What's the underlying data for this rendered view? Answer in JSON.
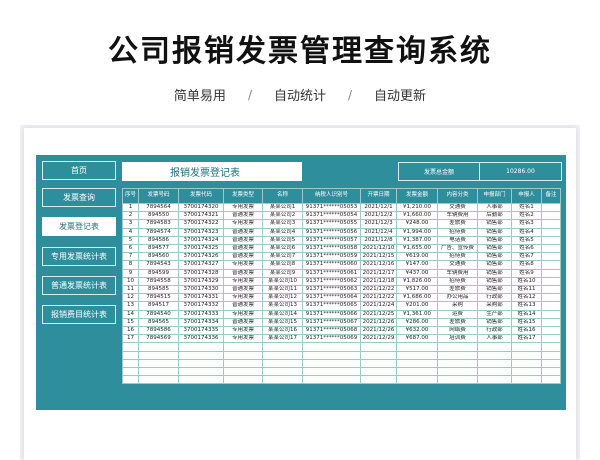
{
  "header": {
    "title": "公司报销发票管理查询系统",
    "features": [
      "简单易用",
      "自动统计",
      "自动更新"
    ]
  },
  "sidebar": {
    "items": [
      {
        "label": "首页",
        "active": false
      },
      {
        "label": "发票查询",
        "active": false
      },
      {
        "label": "发票登记表",
        "active": true
      },
      {
        "label": "专用发票统计表",
        "active": false
      },
      {
        "label": "普通发票统计表",
        "active": false
      },
      {
        "label": "报销费目统计表",
        "active": false
      }
    ]
  },
  "sheet": {
    "title": "报销发票登记表",
    "total_label": "发票总金额",
    "total_value": "10286.00"
  },
  "table": {
    "columns": [
      "序号",
      "发票号码",
      "发票代码",
      "发票类型",
      "名称",
      "纳税人识别号",
      "开票日期",
      "发票金额",
      "内容分类",
      "申报部门",
      "申报人",
      "备注"
    ],
    "rows": [
      [
        "1",
        "7894564",
        "3700174320",
        "专用发票",
        "某某公司1",
        "91371******05053",
        "2021/12/1",
        "¥1,210.00",
        "交通费",
        "人事部",
        "姓名1",
        ""
      ],
      [
        "2",
        "894550",
        "3700174321",
        "普通发票",
        "某某公司2",
        "91371******05054",
        "2021/12/2",
        "¥1,660.00",
        "车辆费用",
        "后勤部",
        "姓名2",
        ""
      ],
      [
        "3",
        "7894583",
        "3700174322",
        "专用发票",
        "某某公司3",
        "91371******05055",
        "2021/12/3",
        "¥248.00",
        "差旅费",
        "销售部",
        "姓名3",
        ""
      ],
      [
        "4",
        "7894574",
        "3700174323",
        "普通发票",
        "某某公司4",
        "91371******05056",
        "2021/12/4",
        "¥1,994.00",
        "招待费",
        "销售部",
        "姓名4",
        ""
      ],
      [
        "5",
        "894586",
        "3700174324",
        "普通发票",
        "某某公司5",
        "91371******05057",
        "2021/12/8",
        "¥1,387.00",
        "电话费",
        "销售部",
        "姓名5",
        ""
      ],
      [
        "6",
        "894577",
        "3700174325",
        "普通发票",
        "某某公司6",
        "91371******05058",
        "2021/12/10",
        "¥1,655.00",
        "广告、宣传费",
        "销售部",
        "姓名6",
        ""
      ],
      [
        "7",
        "894560",
        "3700174326",
        "普通发票",
        "某某公司7",
        "91371******05059",
        "2021/12/15",
        "¥619.00",
        "招待费",
        "销售部",
        "姓名7",
        ""
      ],
      [
        "8",
        "7894543",
        "3700174327",
        "专用发票",
        "某某公司8",
        "91371******05060",
        "2021/12/16",
        "¥147.00",
        "交通费",
        "销售部",
        "姓名8",
        ""
      ],
      [
        "9",
        "894599",
        "3700174328",
        "普通发票",
        "某某公司9",
        "91371******05061",
        "2021/12/17",
        "¥437.00",
        "车辆费用",
        "销售部",
        "姓名9",
        ""
      ],
      [
        "10",
        "7894558",
        "3700174329",
        "专用发票",
        "某某公司10",
        "91371******05062",
        "2021/12/18",
        "¥1,826.00",
        "招待费",
        "销售部",
        "姓名10",
        ""
      ],
      [
        "11",
        "894585",
        "3700174330",
        "普通发票",
        "某某公司11",
        "91371******05063",
        "2021/12/22",
        "¥517.00",
        "差旅费",
        "销售部",
        "姓名11",
        ""
      ],
      [
        "12",
        "7894515",
        "3700174331",
        "专用发票",
        "某某公司12",
        "91371******05064",
        "2021/12/22",
        "¥1,686.00",
        "办公用品",
        "行政部",
        "姓名12",
        ""
      ],
      [
        "13",
        "894517",
        "3700174332",
        "普通发票",
        "某某公司13",
        "91371******05065",
        "2021/12/24",
        "¥201.00",
        "采购",
        "采购部",
        "姓名13",
        ""
      ],
      [
        "14",
        "7894540",
        "3700174333",
        "专用发票",
        "某某公司14",
        "91371******05066",
        "2021/12/25",
        "¥1,361.00",
        "运费",
        "生产部",
        "姓名14",
        ""
      ],
      [
        "15",
        "894565",
        "3700174334",
        "普通发票",
        "某某公司15",
        "91371******05067",
        "2021/12/26",
        "¥286.00",
        "差旅费",
        "销售部",
        "姓名15",
        ""
      ],
      [
        "16",
        "7894586",
        "3700174335",
        "专用发票",
        "某某公司16",
        "91371******05068",
        "2021/12/26",
        "¥632.00",
        "网络费",
        "行政部",
        "姓名16",
        ""
      ],
      [
        "17",
        "7894569",
        "3700174336",
        "专用发票",
        "某某公司17",
        "91371******05069",
        "2021/12/29",
        "¥687.00",
        "培训费",
        "人事部",
        "姓名17",
        ""
      ],
      [
        "",
        "",
        "",
        "",
        "",
        "",
        "",
        "",
        "",
        "",
        "",
        ""
      ],
      [
        "",
        "",
        "",
        "",
        "",
        "",
        "",
        "",
        "",
        "",
        "",
        ""
      ],
      [
        "",
        "",
        "",
        "",
        "",
        "",
        "",
        "",
        "",
        "",
        "",
        ""
      ],
      [
        "",
        "",
        "",
        "",
        "",
        "",
        "",
        "",
        "",
        "",
        "",
        ""
      ],
      [
        "",
        "",
        "",
        "",
        "",
        "",
        "",
        "",
        "",
        "",
        "",
        ""
      ]
    ]
  },
  "colors": {
    "app_background": "#2f8e9b",
    "accent_text": "#1f6f7a",
    "grid_line": "#9fc7cd"
  }
}
